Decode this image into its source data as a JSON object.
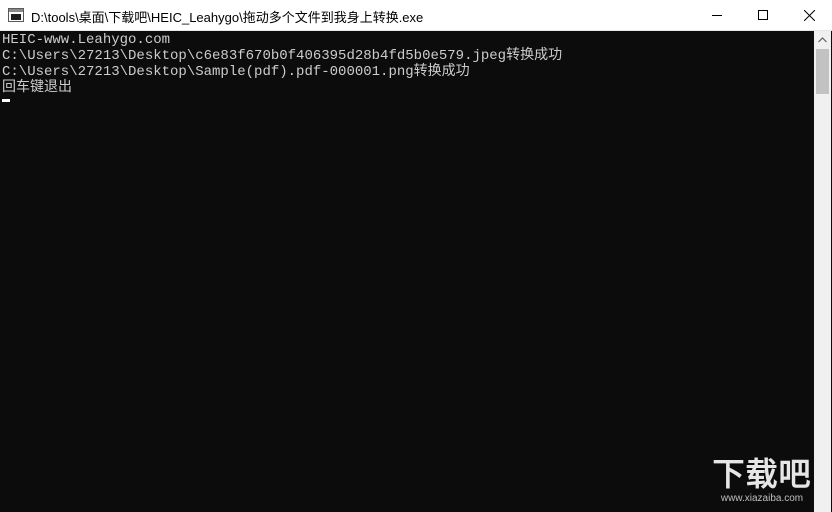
{
  "window": {
    "title": "D:\\tools\\桌面\\下载吧\\HEIC_Leahygo\\拖动多个文件到我身上转换.exe",
    "icon": "console-app-icon"
  },
  "controls": {
    "minimize_icon": "minimize-icon",
    "maximize_icon": "maximize-icon",
    "close_icon": "close-icon"
  },
  "console": {
    "lines": [
      "HEIC-www.Leahygo.com",
      "C:\\Users\\27213\\Desktop\\c6e83f670b0f406395d28b4fd5b0e579.jpeg转换成功",
      "C:\\Users\\27213\\Desktop\\Sample(pdf).pdf-000001.png转换成功",
      "回车键退出"
    ],
    "text_color": "#cccccc",
    "background": "#0c0c0c"
  },
  "watermark": {
    "main": "下载吧",
    "sub": "www.xiazaiba.com"
  }
}
